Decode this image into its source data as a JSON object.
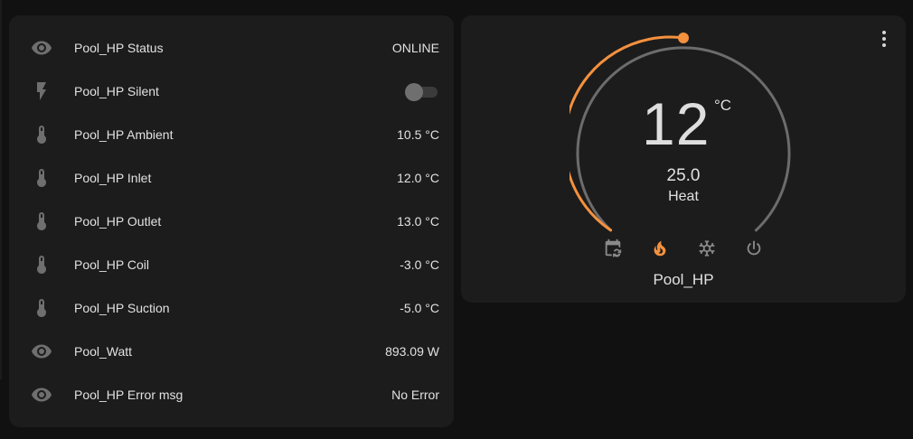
{
  "entities": [
    {
      "icon": "eye-icon",
      "name": "Pool_HP Status",
      "value": "ONLINE"
    },
    {
      "icon": "lightning-icon",
      "name": "Pool_HP Silent",
      "toggle": false
    },
    {
      "icon": "thermometer-icon",
      "name": "Pool_HP Ambient",
      "value": "10.5 °C"
    },
    {
      "icon": "thermometer-icon",
      "name": "Pool_HP Inlet",
      "value": "12.0 °C"
    },
    {
      "icon": "thermometer-icon",
      "name": "Pool_HP Outlet",
      "value": "13.0 °C"
    },
    {
      "icon": "thermometer-icon",
      "name": "Pool_HP Coil",
      "value": "-3.0 °C"
    },
    {
      "icon": "thermometer-icon",
      "name": "Pool_HP Suction",
      "value": "-5.0 °C"
    },
    {
      "icon": "eye-icon",
      "name": "Pool_Watt",
      "value": "893.09 W"
    },
    {
      "icon": "eye-icon",
      "name": "Pool_HP Error msg",
      "value": "No Error"
    }
  ],
  "thermostat": {
    "current_temp": "12",
    "unit": "°C",
    "target_temp": "25.0",
    "mode": "Heat",
    "name": "Pool_HP",
    "modes": [
      {
        "icon": "calendar-sync-icon",
        "active": false
      },
      {
        "icon": "fire-icon",
        "active": true
      },
      {
        "icon": "snowflake-icon",
        "active": false
      },
      {
        "icon": "power-icon",
        "active": false
      }
    ],
    "colors": {
      "heat": "#f4913e",
      "inactive_arc": "#6c6c6c",
      "inactive_icon": "#8a8a8a"
    }
  }
}
